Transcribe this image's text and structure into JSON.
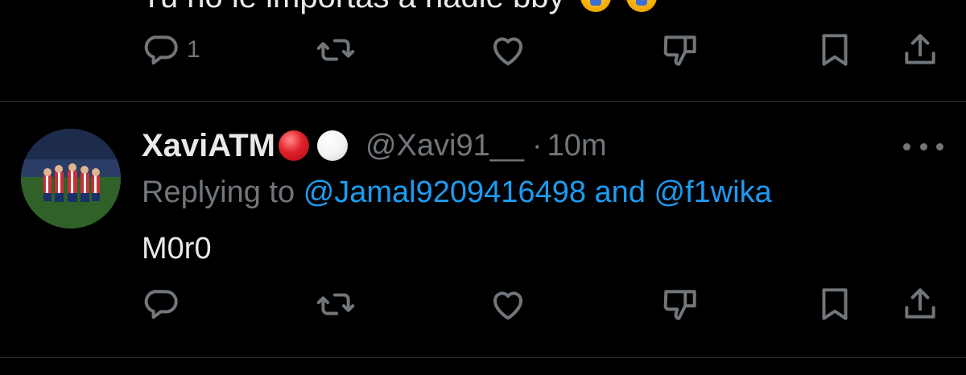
{
  "previous_tweet": {
    "text_partial": "Tu no le importas a nadie bby",
    "emojis": [
      "crying-face",
      "crying-face"
    ],
    "actions": {
      "reply_count": "1",
      "retweet_count": "",
      "like_count": "",
      "dislike_count": ""
    }
  },
  "tweet": {
    "display_name": "XaviATM",
    "name_emojis": [
      "red-circle",
      "white-circle"
    ],
    "handle": "@Xavi91__",
    "separator": "·",
    "time": "10m",
    "replying_prefix": "Replying to",
    "replying_to": [
      "@Jamal9209416498",
      "@f1wika"
    ],
    "replying_joiner": "and",
    "body": "M0r0",
    "actions": {
      "reply_count": "",
      "retweet_count": "",
      "like_count": "",
      "dislike_count": ""
    }
  },
  "colors": {
    "background": "#000000",
    "text": "#e7e9ea",
    "muted": "#71767b",
    "link": "#1d9bf0",
    "divider": "#2f3336"
  },
  "icons": [
    "reply-icon",
    "retweet-icon",
    "like-icon",
    "dislike-icon",
    "bookmark-icon",
    "share-icon",
    "more-icon"
  ]
}
